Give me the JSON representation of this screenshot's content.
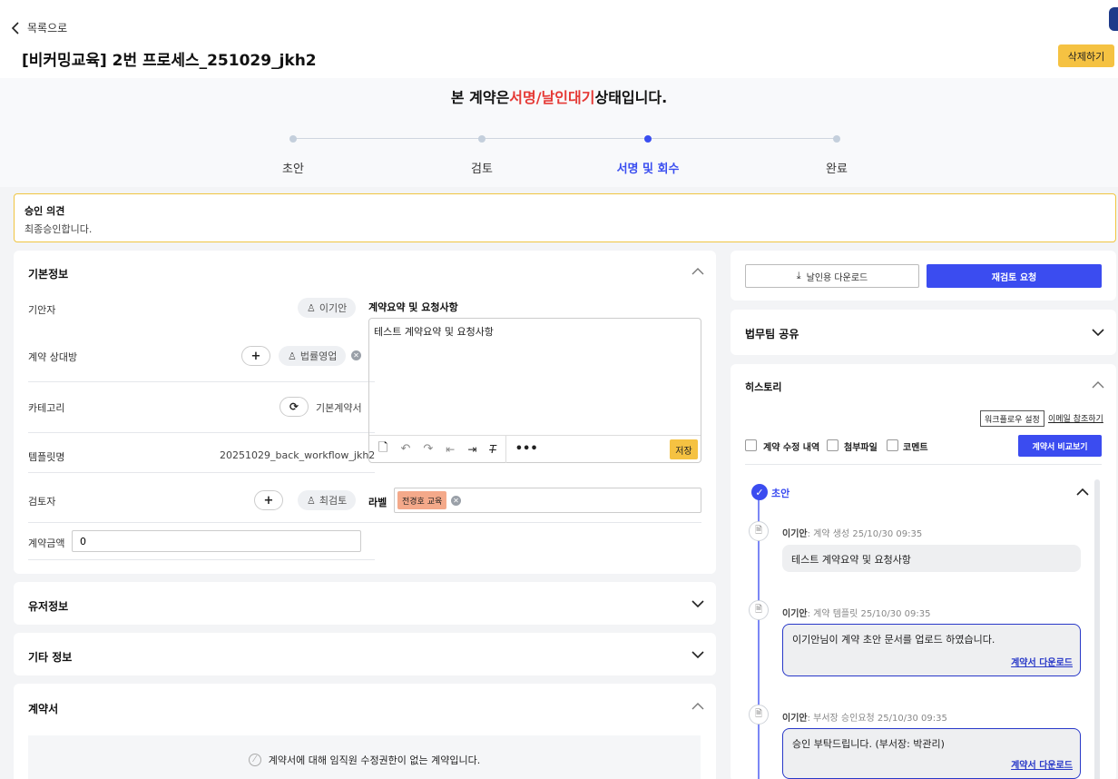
{
  "header": {
    "back_label": "목록으로",
    "title": "[비커밍교육] 2번 프로세스_251029_jkh2",
    "delete_label": "삭제하기"
  },
  "status": {
    "prefix": "본 계약은 ",
    "highlight": "서명/날인대기",
    "suffix": " 상태입니다.",
    "highlight_color": "#e53935"
  },
  "steps": [
    {
      "label": "초안",
      "active": false
    },
    {
      "label": "검토",
      "active": false
    },
    {
      "label": "서명 및 회수",
      "active": true
    },
    {
      "label": "완료",
      "active": false
    }
  ],
  "approval": {
    "heading": "승인 의견",
    "body": "최종승인합니다."
  },
  "basic_info": {
    "title": "기본정보",
    "drafter_label": "기안자",
    "drafter_value": "이기안",
    "counterparty_label": "계약 상대방",
    "counterparty_value": "법률영업",
    "category_label": "카테고리",
    "category_value": "기본계약서",
    "template_label": "템플릿명",
    "template_value": "20251029_back_workflow_jkh2",
    "reviewer_label": "검토자",
    "reviewer_value": "최검토",
    "amount_label": "계약금액",
    "amount_value": "0",
    "summary_label": "계약요약 및 요청사항",
    "summary_text": "테스트 계약요약 및 요청사항",
    "save_label": "저장",
    "tag_label": "라벨",
    "tag_value": "전경호 교육"
  },
  "user_info": {
    "title": "유저정보"
  },
  "etc_info": {
    "title": "기타 정보"
  },
  "contract": {
    "title": "계약서",
    "notice": "계약서에 대해 임직원 수정권한이 없는 계약입니다."
  },
  "actions": {
    "download_label": "날인용 다운로드",
    "rereview_label": "재검토 요청"
  },
  "legal_share": {
    "title": "법무팀 공유"
  },
  "history": {
    "title": "히스토리",
    "workflow_settings": "워크플로우 설정",
    "email_cc": "이메일 참조하기",
    "filters": [
      "계약 수정 내역",
      "첨부파일",
      "코멘트"
    ],
    "compare_label": "계약서 비교보기",
    "group_label": "초안",
    "entries": [
      {
        "author": "이기안",
        "action": ": 계약 생성 ",
        "time": "25/10/30 09:35",
        "text": "테스트 계약요약 및 요청사항",
        "download": ""
      },
      {
        "author": "이기안",
        "action": ": 계약 템플릿 ",
        "time": "25/10/30 09:35",
        "text": "이기안님이 계약 초안 문서를 업로드 하였습니다.",
        "download": "계약서 다운로드"
      },
      {
        "author": "이기안",
        "action": ": 부서장 승인요청 ",
        "time": "25/10/30 09:35",
        "text": "승인 부탁드립니다. (부서장: 박관리)",
        "download": "계약서 다운로드"
      }
    ]
  }
}
